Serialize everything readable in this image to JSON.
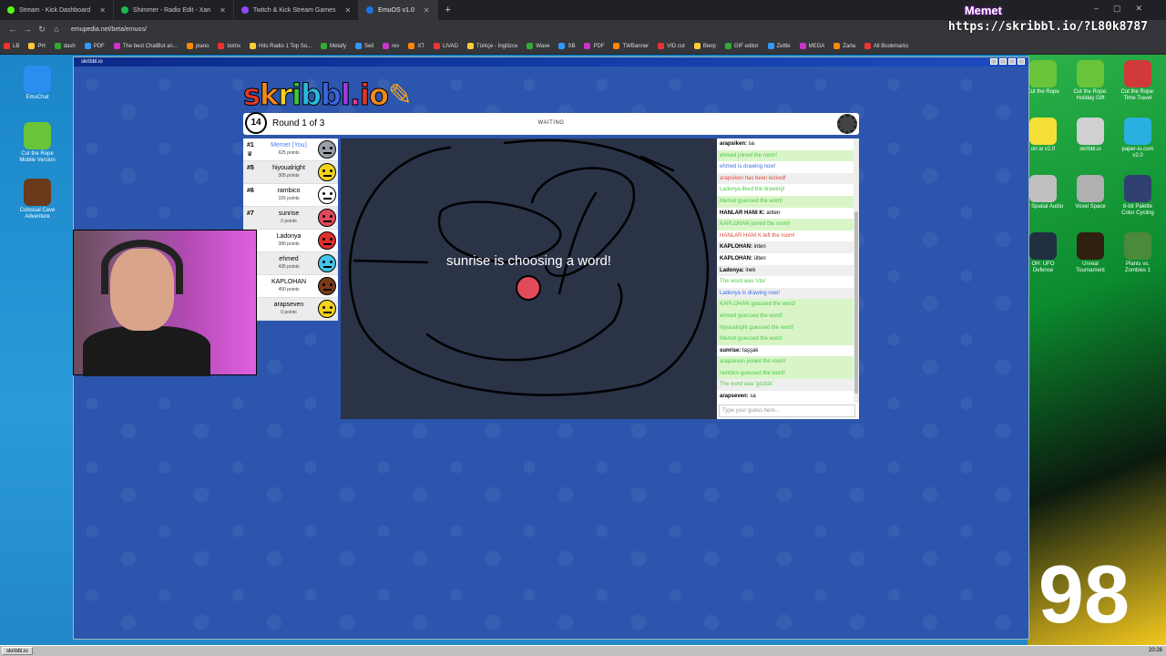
{
  "browser": {
    "tabs": [
      {
        "label": "Stream - Kick Dashboard",
        "color": "#53fc18"
      },
      {
        "label": "Shimmer - Radio Edit - Xan",
        "color": "#1db954"
      },
      {
        "label": "Twitch & Kick Stream Games",
        "color": "#9146ff"
      },
      {
        "label": "EmuOS v1.0",
        "color": "#1a73e8"
      }
    ],
    "url": "emupedia.net/beta/emuos/",
    "bookmarks": [
      "LB",
      "PH",
      "dash",
      "PDF",
      "The best ChatBot an...",
      "piano",
      "botrix",
      "Hits Radio 1 Top So...",
      "Metafy",
      "Sell",
      "rev",
      "XT",
      "LIVAD",
      "Türkçe - İngilizce",
      "Wave",
      "SB",
      "PDF",
      "TWBanner",
      "VID cut",
      "Bierp",
      "GIF editor",
      "Zettle",
      "MEGA",
      "Zarla",
      "All Bookmarks"
    ],
    "overlay_name": "Memet",
    "overlay_url": "https://skribbl.io/?L80k8787"
  },
  "window": {
    "title": "skribbl.io"
  },
  "game": {
    "logo": "skribbl.io",
    "timer": "14",
    "round": "Round 1 of 3",
    "status": "WAITING",
    "choosing": "sunrise is choosing a word!",
    "players": [
      {
        "rank": "#1",
        "name": "Memet (You)",
        "points": "625 points",
        "you": true,
        "color": "#9aa0a6"
      },
      {
        "rank": "#5",
        "name": "hiyoualright",
        "points": "305 points",
        "color": "#f2d21b"
      },
      {
        "rank": "#6",
        "name": "rambico",
        "points": "155 points",
        "color": "#ffffff"
      },
      {
        "rank": "#7",
        "name": "sunrise",
        "points": "0 points",
        "color": "#e04a5a"
      },
      {
        "rank": "",
        "name": "Ladonya",
        "points": "380 points",
        "color": "#e03030"
      },
      {
        "rank": "",
        "name": "ehmed",
        "points": "435 points",
        "color": "#44c4e8"
      },
      {
        "rank": "",
        "name": "KAPLOHAN",
        "points": "450 points",
        "color": "#7a3a1a"
      },
      {
        "rank": "",
        "name": "arapseven",
        "points": "0 points",
        "color": "#f2d21b"
      }
    ],
    "chat": [
      {
        "user": "arapsiken:",
        "text": " sa",
        "type": "normal"
      },
      {
        "user": "",
        "text": "ehmed joined the room!",
        "type": "green"
      },
      {
        "user": "",
        "text": "ehmed is drawing now!",
        "type": "blue"
      },
      {
        "user": "",
        "text": "arapsiken has been kicked!",
        "type": "red"
      },
      {
        "user": "",
        "text": "Ladonya liked the drawing!",
        "type": "lime"
      },
      {
        "user": "",
        "text": "Memet guessed the word!",
        "type": "green"
      },
      {
        "user": "HANLAR HANI K:",
        "text": " anten",
        "type": "normal"
      },
      {
        "user": "",
        "text": "KAPLOHAN joined the room!",
        "type": "green"
      },
      {
        "user": "",
        "text": "HANLAR HANI K left the room!",
        "type": "red"
      },
      {
        "user": "KAPLOHAN:",
        "text": " inten",
        "type": "normal"
      },
      {
        "user": "KAPLOHAN:",
        "text": " ülten",
        "type": "normal"
      },
      {
        "user": "Ladonya:",
        "text": " inek",
        "type": "normal"
      },
      {
        "user": "",
        "text": "The word was 'inte'",
        "type": "lime"
      },
      {
        "user": "",
        "text": "Ladonya is drawing now!",
        "type": "blue"
      },
      {
        "user": "",
        "text": "KAPLOHAN guessed the word!",
        "type": "green"
      },
      {
        "user": "",
        "text": "ehmed guessed the word!",
        "type": "green"
      },
      {
        "user": "",
        "text": "hiyoualright guessed the word!",
        "type": "green"
      },
      {
        "user": "",
        "text": "Memet guessed the word!",
        "type": "green"
      },
      {
        "user": "sunrise:",
        "text": " taşşak",
        "type": "normal"
      },
      {
        "user": "",
        "text": "arapseven joined the room!",
        "type": "green"
      },
      {
        "user": "",
        "text": "rambico guessed the word!",
        "type": "green"
      },
      {
        "user": "",
        "text": "The word was 'gözlük'",
        "type": "lime"
      },
      {
        "user": "arapseven:",
        "text": " sa",
        "type": "normal"
      }
    ],
    "chat_placeholder": "Type your guess here..."
  },
  "desktop": {
    "left_icons": [
      "EmuChat",
      "Cut the Rope Mobile Version",
      "Colossal Cave Adventure"
    ],
    "right_icons": [
      "Cut the Rope",
      "Cut the Rope: Holiday Gift",
      "Cut the Rope: Time Travel",
      "orr.io v2.0",
      "skribbl.io",
      "paper-io.com v2.0",
      "3D Spatial Audio",
      "Voxel Space",
      "8-bit Palette Color Cycling",
      "OH: UFO Defense",
      "Unreal Tournament",
      "Plants vs. Zombies 1"
    ],
    "big_text": "98"
  },
  "taskbar": {
    "item": "skribbl.io",
    "clock": "20:26"
  }
}
